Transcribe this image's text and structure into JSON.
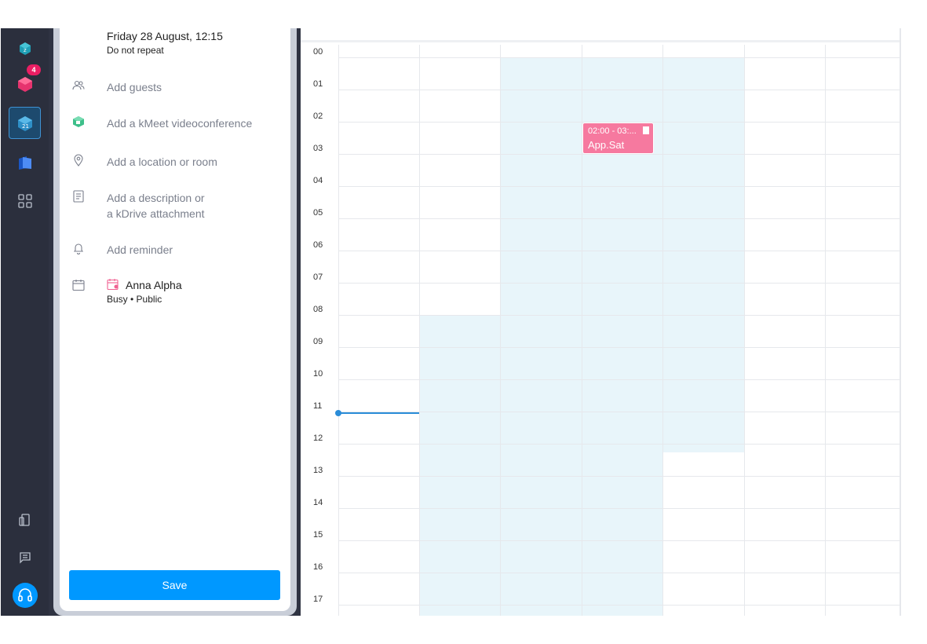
{
  "rail": {
    "notification_badge": "4",
    "help_icon": "headset-icon"
  },
  "event_form": {
    "date_time": "Friday 28 August, 12:15",
    "repeat": "Do not repeat",
    "add_guests": "Add guests",
    "add_videoconference": "Add a kMeet videoconference",
    "add_location": "Add a location or room",
    "add_description_line1": "Add a description or",
    "add_description_line2": "a kDrive attachment",
    "add_reminder": "Add reminder",
    "calendar_owner": "Anna Alpha",
    "availability": "Busy • Public",
    "save_label": "Save"
  },
  "calendar": {
    "hours": [
      "00",
      "01",
      "02",
      "03",
      "04",
      "05",
      "06",
      "07",
      "08",
      "09",
      "10",
      "11",
      "12",
      "13",
      "14",
      "15",
      "16",
      "17"
    ],
    "event": {
      "time": "02:00 - 03:...",
      "title": "App.Sat",
      "color": "#f6799f"
    },
    "shade_color": "#e8f5fa",
    "now_line_color": "#2a8cd8"
  },
  "colors": {
    "rail_bg": "#2b2f3d",
    "primary": "#0098ff"
  }
}
